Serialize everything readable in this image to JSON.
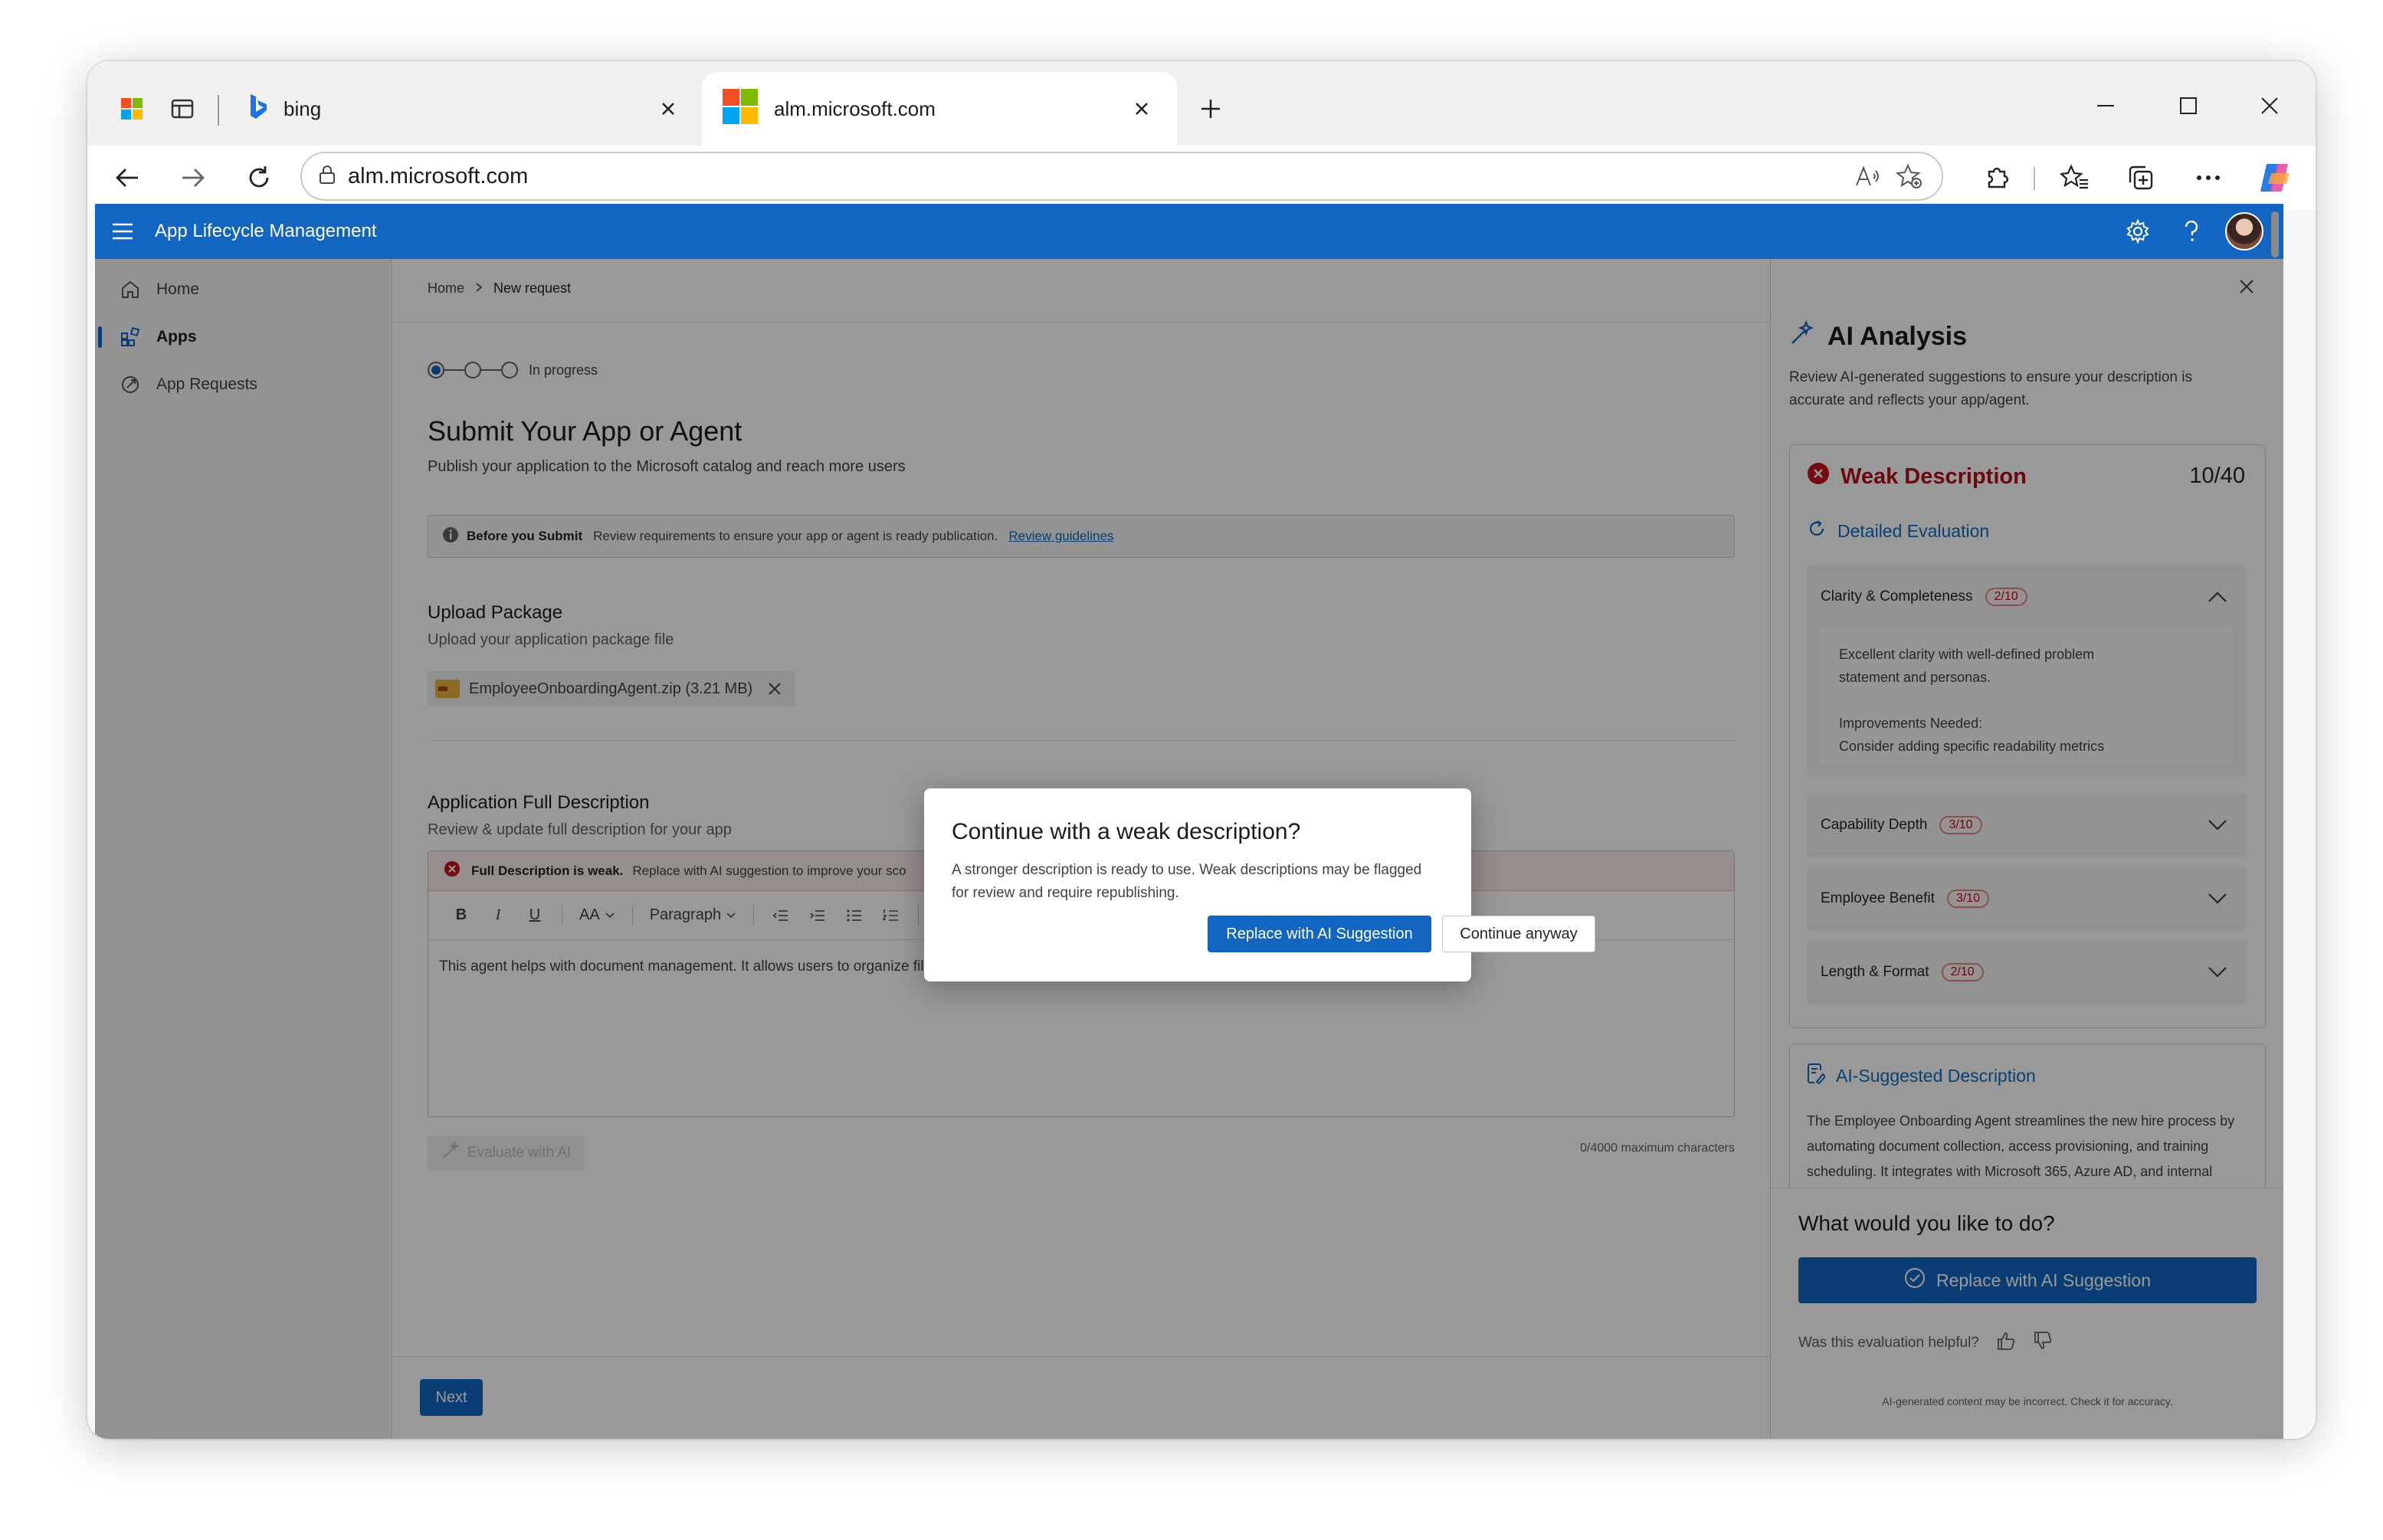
{
  "browser": {
    "tabs": [
      {
        "label": "bing",
        "active": false
      },
      {
        "label": "alm.microsoft.com",
        "active": true
      }
    ],
    "url": "alm.microsoft.com"
  },
  "app": {
    "title": "App Lifecycle Management",
    "accent": "#1266c1"
  },
  "sidebar": {
    "items": [
      {
        "label": "Home",
        "icon": "home-icon",
        "selected": false
      },
      {
        "label": "Apps",
        "icon": "apps-icon",
        "selected": true
      },
      {
        "label": "App Requests",
        "icon": "app-requests-icon",
        "selected": false
      }
    ]
  },
  "main": {
    "breadcrumb": [
      "Home",
      "New request"
    ],
    "progress_label": "In progress",
    "title": "Submit Your App or Agent",
    "subtitle": "Publish your application to the Microsoft catalog and reach more users",
    "info": {
      "title": "Before you Submit",
      "text": "Review requirements to ensure your app or agent is ready publication.",
      "link": "Review guidelines"
    },
    "upload": {
      "title": "Upload Package",
      "subtitle": "Upload your application package file",
      "file": "EmployeeOnboardingAgent.zip (3.21 MB)"
    },
    "description": {
      "title": "Application Full Description",
      "subtitle": "Review & update full description for your app",
      "warning_title": "Full Description is weak.",
      "warning_text": "Replace with AI suggestion to improve your sco",
      "format": {
        "font_size": "AA",
        "paragraph": "Paragraph"
      },
      "text": "This agent helps with document management. It allows users to organize files and search for documents. The agent simplifies the process of finding information.",
      "char_count": "0/4000 maximum characters",
      "evaluate_label": "Evaluate with AI"
    },
    "next_label": "Next"
  },
  "panel": {
    "title": "AI Analysis",
    "description": "Review AI-generated suggestions to ensure your description is accurate and reflects your app/agent.",
    "status": "Weak Description",
    "score": "10/40",
    "detailed_label": "Detailed Evaluation",
    "criteria": [
      {
        "label": "Clarity & Completeness",
        "score": "2/10",
        "expanded": true,
        "details": [
          "Excellent clarity with well-defined problem",
          "statement and personas.",
          "",
          "Improvements Needed:",
          "Consider adding specific readability metrics"
        ]
      },
      {
        "label": "Capability Depth",
        "score": "3/10",
        "expanded": false
      },
      {
        "label": "Employee Benefit",
        "score": "3/10",
        "expanded": false
      },
      {
        "label": "Length & Format",
        "score": "2/10",
        "expanded": false
      }
    ],
    "suggestion": {
      "title": "AI-Suggested Description",
      "text": "The Employee Onboarding Agent streamlines the new hire process by automating document collection, access provisioning, and training scheduling. It integrates with Microsoft 365, Azure AD, and internal HR systems to ensure a"
    },
    "question": "What would you like to do?",
    "replace_label": "Replace with AI Suggestion",
    "helpful_label": "Was this evaluation helpful?",
    "disclaimer": "AI-generated content may be incorrect. Check it for accuracy."
  },
  "dialog": {
    "title": "Continue with a weak description?",
    "text": "A stronger description is ready to use. Weak descriptions may be flagged for review and require republishing.",
    "primary": "Replace with AI Suggestion",
    "secondary": "Continue anyway"
  }
}
